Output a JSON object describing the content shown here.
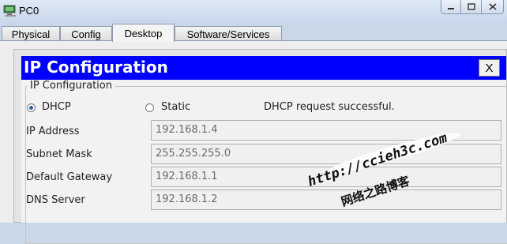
{
  "window": {
    "title": "PC0"
  },
  "tabs": [
    {
      "label": "Physical"
    },
    {
      "label": "Config"
    },
    {
      "label": "Desktop",
      "active": true
    },
    {
      "label": "Software/Services"
    }
  ],
  "dialog": {
    "title": "IP Configuration",
    "close_label": "X",
    "group_label": "IP Configuration",
    "mode_dhcp": "DHCP",
    "mode_static": "Static",
    "selected_mode": "DHCP",
    "status": "DHCP request successful.",
    "fields": [
      {
        "label": "IP Address",
        "value": "192.168.1.4"
      },
      {
        "label": "Subnet Mask",
        "value": "255.255.255.0"
      },
      {
        "label": "Default Gateway",
        "value": "192.168.1.1"
      },
      {
        "label": "DNS Server",
        "value": "192.168.1.2"
      }
    ]
  },
  "watermark": {
    "line1": "http://ccieh3c.com",
    "line2": "网络之路博客"
  },
  "colors": {
    "dialog_title_bg": "#0000ff",
    "window_bg": "#c9d7e8"
  }
}
